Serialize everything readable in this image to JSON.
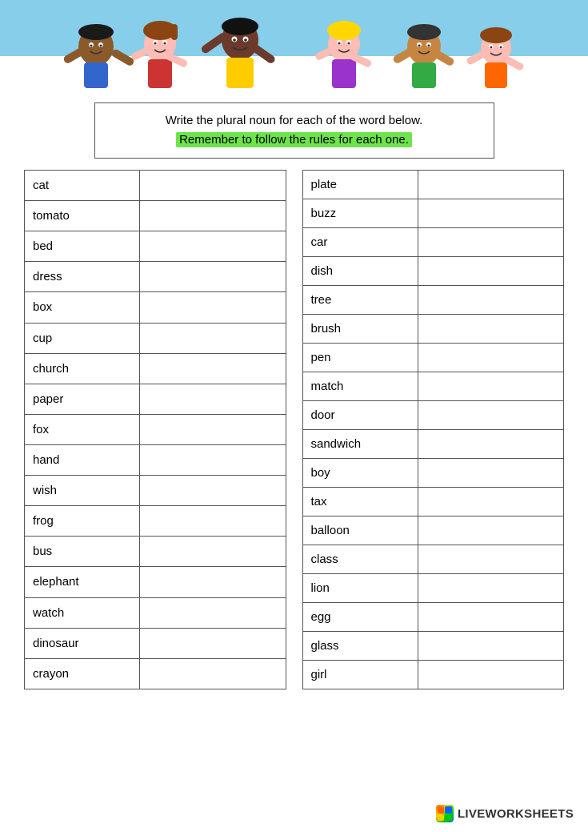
{
  "header": {
    "alt": "Cartoon children banner"
  },
  "instructions": {
    "line1": "Write the plural noun for each of the word below.",
    "line2": "Remember to follow the rules for each one."
  },
  "left_table": {
    "words": [
      "cat",
      "tomato",
      "bed",
      "dress",
      "box",
      "cup",
      "church",
      "paper",
      "fox",
      "hand",
      "wish",
      "frog",
      "bus",
      "elephant",
      "watch",
      "dinosaur",
      "crayon"
    ]
  },
  "right_table": {
    "words": [
      "plate",
      "buzz",
      "car",
      "dish",
      "tree",
      "brush",
      "pen",
      "match",
      "door",
      "sandwich",
      "boy",
      "tax",
      "balloon",
      "class",
      "lion",
      "egg",
      "glass",
      "girl"
    ]
  },
  "footer": {
    "logo_text": "LIVEWORKSHEETS"
  }
}
